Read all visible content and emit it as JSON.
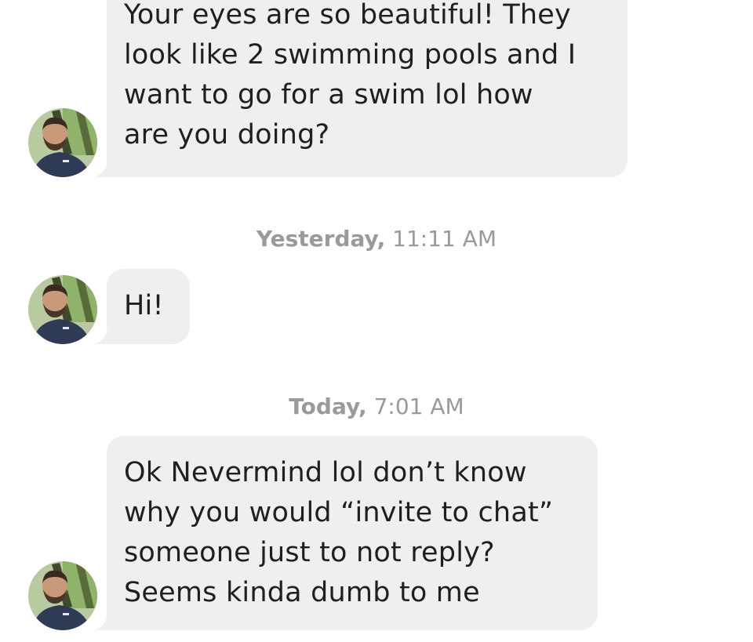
{
  "conversation": {
    "messages": [
      {
        "lines": [
          "Your eyes are so beautiful! They",
          "look like 2 swimming pools and I",
          "want to go for a swim lol how",
          "are you doing?"
        ]
      },
      {
        "timestamp": {
          "day": "Yesterday,",
          "time": "11:11 AM"
        },
        "lines": [
          "Hi!"
        ]
      },
      {
        "timestamp": {
          "day": "Today,",
          "time": "7:01 AM"
        },
        "lines": [
          "Ok Nevermind lol don’t know",
          "why you would “invite to chat”",
          "someone just to not reply?",
          "Seems kinda dumb to me"
        ]
      }
    ]
  },
  "colors": {
    "bubble_bg": "#efefef",
    "message_text": "#1f1f1f",
    "timestamp_text": "#9a9a9a",
    "background": "#ffffff"
  },
  "icons": {
    "avatar": "user-avatar-photo"
  }
}
